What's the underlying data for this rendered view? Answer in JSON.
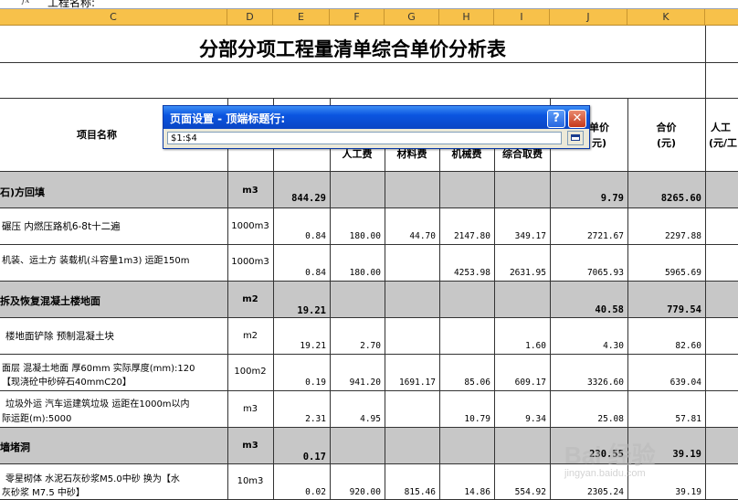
{
  "formula_bar": {
    "fx_label": "fx",
    "cell_text": "工程名称:"
  },
  "columns": [
    "C",
    "D",
    "E",
    "F",
    "G",
    "H",
    "I",
    "J",
    "K"
  ],
  "sheet": {
    "title": "分部分项工程量清单综合单价分析表",
    "header": {
      "item_name": "项目名称",
      "unit_price": "单价",
      "unit_price_unit": "元)",
      "total": "合价",
      "total_unit": "(元)",
      "labor_partial": "人工",
      "labor_partial_unit": "(元/工",
      "labor_fee": "人工费",
      "material_fee": "材料费",
      "machine_fee": "机械费",
      "overhead_fee": "综合取费"
    },
    "rows": [
      {
        "name": "石)方回填",
        "unit": "m3",
        "qty": "844.29",
        "labor": "",
        "material": "",
        "machine": "",
        "overhead": "",
        "price": "9.79",
        "total": "8265.60"
      },
      {
        "name": "碾压 内燃压路机6-8t十二遍",
        "unit": "1000m3",
        "qty": "0.84",
        "labor": "180.00",
        "material": "44.70",
        "machine": "2147.80",
        "overhead": "349.17",
        "price": "2721.67",
        "total": "2297.88"
      },
      {
        "name": "机装、运土方 装载机(斗容量1m3) 运距150m",
        "unit": "1000m3",
        "qty": "0.84",
        "labor": "180.00",
        "material": "",
        "machine": "4253.98",
        "overhead": "2631.95",
        "price": "7065.93",
        "total": "5965.69"
      },
      {
        "name": "拆及恢复混凝土楼地面",
        "unit": "m2",
        "qty": "19.21",
        "labor": "",
        "material": "",
        "machine": "",
        "overhead": "",
        "price": "40.58",
        "total": "779.54"
      },
      {
        "name": "楼地面铲除 预制混凝土块",
        "unit": "m2",
        "qty": "19.21",
        "labor": "2.70",
        "material": "",
        "machine": "",
        "overhead": "1.60",
        "price": "4.30",
        "total": "82.60"
      },
      {
        "name": "面层 混凝土地面 厚60mm  实际厚度(mm):120",
        "name2": "【现浇砼中砂碎石40mmC20】",
        "unit": "100m2",
        "qty": "0.19",
        "labor": "941.20",
        "material": "1691.17",
        "machine": "85.06",
        "overhead": "609.17",
        "price": "3326.60",
        "total": "639.04"
      },
      {
        "name": "垃圾外运 汽车运建筑垃圾 运距在1000m以内",
        "name2": "际运距(m):5000",
        "unit": "m3",
        "qty": "2.31",
        "labor": "4.95",
        "material": "",
        "machine": "10.79",
        "overhead": "9.34",
        "price": "25.08",
        "total": "57.81"
      },
      {
        "name": "墙堵洞",
        "unit": "m3",
        "qty": "0.17",
        "labor": "",
        "material": "",
        "machine": "",
        "overhead": "",
        "price": "230.55",
        "total": "39.19"
      },
      {
        "name": "零星砌体 水泥石灰砂浆M5.0中砂 换为【水",
        "name2": "灰砂浆 M7.5 中砂】",
        "unit": "10m3",
        "qty": "0.02",
        "labor": "920.00",
        "material": "815.46",
        "machine": "14.86",
        "overhead": "554.92",
        "price": "2305.24",
        "total": "39.19"
      }
    ]
  },
  "dialog": {
    "title": "页面设置 - 顶端标题行:",
    "input_value": "$1:$4",
    "help_label": "?",
    "close_label": "✕"
  },
  "watermark": {
    "text": "Bai 经验",
    "url": "jingyan.baidu.com"
  },
  "colors": {
    "band": "#c7c7c7",
    "col_header": "#f7c14a",
    "dialog_title": "#0b55e0"
  }
}
